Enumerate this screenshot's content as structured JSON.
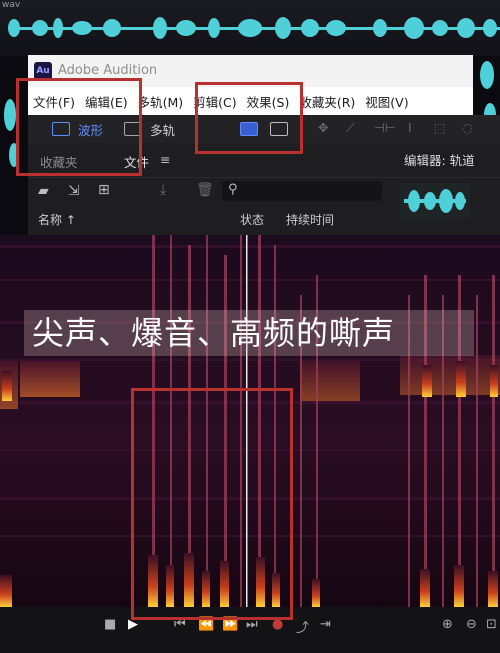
{
  "window": {
    "file_label": "wav",
    "app_logo": "Au",
    "app_title": "Adobe Audition"
  },
  "menu": [
    {
      "label": "文件(F)"
    },
    {
      "label": "编辑(E)"
    },
    {
      "label": "多轨(M)"
    },
    {
      "label": "剪辑(C)"
    },
    {
      "label": "效果(S)"
    },
    {
      "label": "收藏夹(R)"
    },
    {
      "label": "视图(V)"
    }
  ],
  "toolbar": {
    "waveform_label": "波形",
    "multitrack_label": "多轨",
    "waveform_icon": "waveform-view-icon",
    "multitrack_icon": "multitrack-view-icon"
  },
  "panel": {
    "tabs": [
      {
        "label": "收藏夹"
      },
      {
        "label": "文件"
      }
    ],
    "columns": {
      "name": "名称 ↑",
      "status": "状态",
      "duration": "持续时间"
    },
    "editor_header": "编辑器: 轨道"
  },
  "caption": "尖声、爆音、高频的嘶声",
  "colors": {
    "highlight": "#b8302f",
    "accent_blue": "#5d8cff",
    "waveform": "#4fd0d8"
  }
}
